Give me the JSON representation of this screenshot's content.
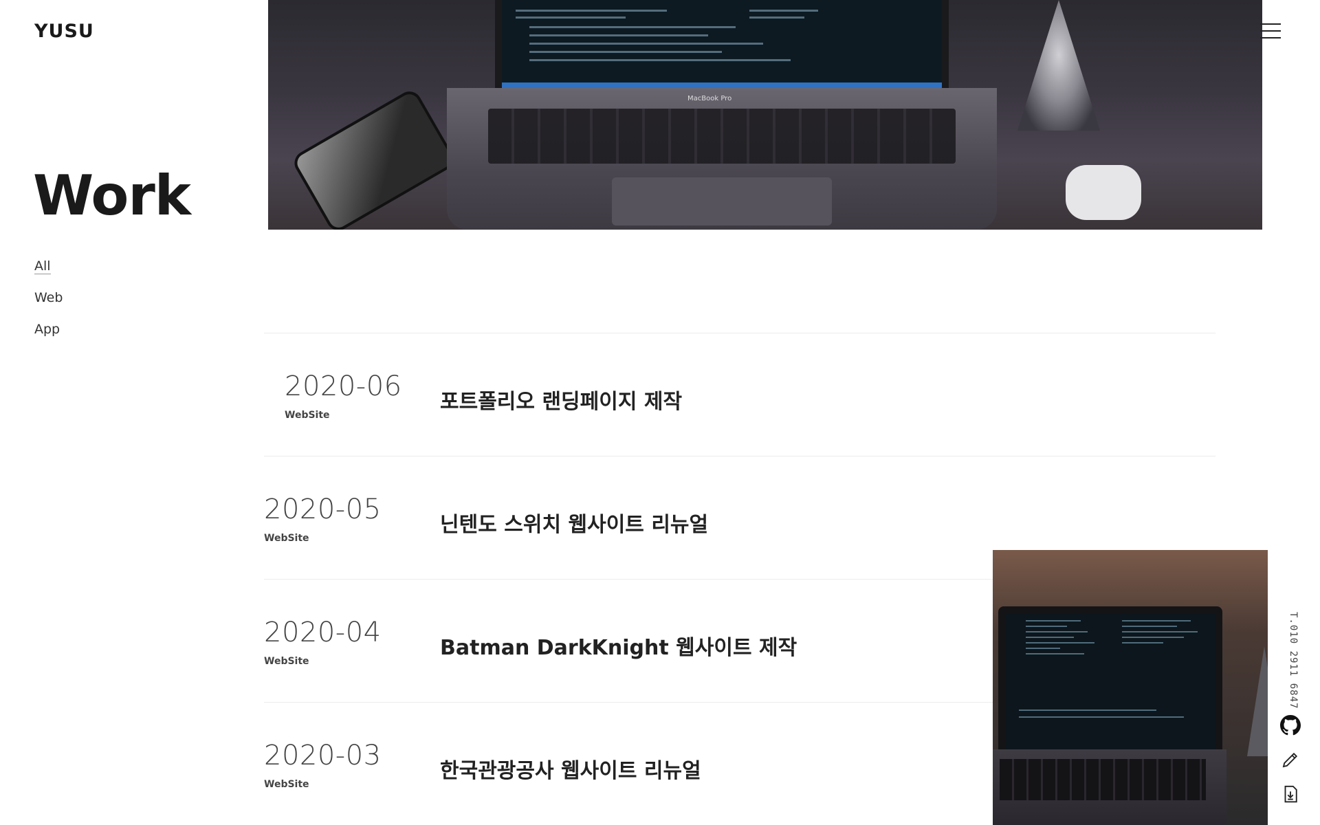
{
  "header": {
    "logo": "YUSU"
  },
  "page": {
    "title": "Work"
  },
  "filters": [
    {
      "label": "All",
      "active": true
    },
    {
      "label": "Web",
      "active": false
    },
    {
      "label": "App",
      "active": false
    }
  ],
  "hero": {
    "laptop_label": "MacBook Pro"
  },
  "works": [
    {
      "date": "2020-06",
      "category": "WebSite",
      "title": "포트폴리오 랜딩페이지 제작"
    },
    {
      "date": "2020-05",
      "category": "WebSite",
      "title": "닌텐도 스위치 웹사이트 리뉴얼"
    },
    {
      "date": "2020-04",
      "category": "WebSite",
      "title": "Batman DarkKnight 웹사이트 제작"
    },
    {
      "date": "2020-03",
      "category": "WebSite",
      "title": "한국관광공사 웹사이트 리뉴얼"
    }
  ],
  "side": {
    "phone": "T.010 2911 6847",
    "icons": [
      "github-icon",
      "pencil-icon",
      "download-icon"
    ]
  }
}
